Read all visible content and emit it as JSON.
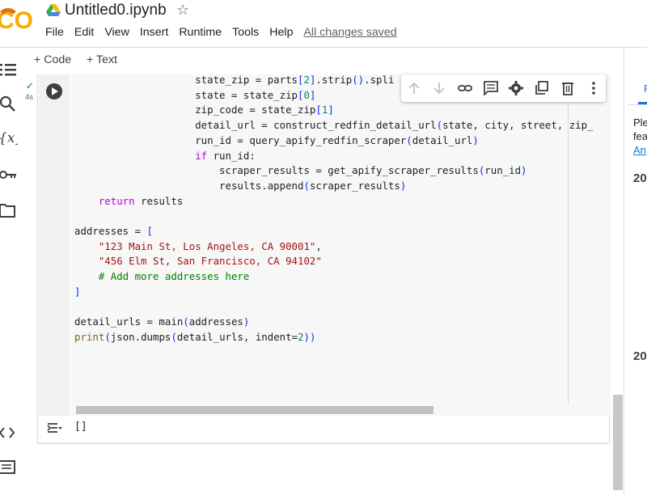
{
  "app": {
    "logo_text": "CO",
    "notebook_title": "Untitled0.ipynb",
    "menu": [
      "File",
      "Edit",
      "View",
      "Insert",
      "Runtime",
      "Tools",
      "Help"
    ],
    "save_status": "All changes saved"
  },
  "toolbar": {
    "add_code": "+ Code",
    "add_text": "+ Text"
  },
  "sidebar_icons": [
    "table-of-contents-icon",
    "search-icon",
    "variables-icon",
    "key-icon",
    "folder-icon",
    "code-snippets-icon",
    "terminal-icon"
  ],
  "cell": {
    "status": "✓",
    "exec_time": "4s",
    "code_lines": [
      "                    state_zip = parts[2].strip().spli",
      "                    state = state_zip[0]",
      "                    zip_code = state_zip[1]",
      "                    detail_url = construct_redfin_detail_url(state, city, street, zip_",
      "                    run_id = query_apify_redfin_scraper(detail_url)",
      "                    if run_id:",
      "                        scraper_results = get_apify_scraper_results(run_id)",
      "                        results.append(scraper_results)",
      "    return results",
      "",
      "addresses = [",
      "    \"123 Main St, Los Angeles, CA 90001\",",
      "    \"456 Elm St, San Francisco, CA 94102\"",
      "    # Add more addresses here",
      "]",
      "",
      "detail_urls = main(addresses)",
      "print(json.dumps(detail_urls, indent=2))"
    ],
    "output": "[]"
  },
  "cell_toolbar_icons": [
    "move-up-icon",
    "move-down-icon",
    "link-icon",
    "comment-icon",
    "settings-icon",
    "mirror-cell-icon",
    "delete-icon",
    "more-options-icon"
  ],
  "right_panel": {
    "tab_label": "F",
    "text_line1": "Ple",
    "text_line2": "fea",
    "link": "An",
    "heading1": "20",
    "heading2": "20"
  },
  "colors": {
    "accent": "#1a73e8",
    "keyword": "#af00db",
    "string": "#a31515",
    "number": "#098658",
    "comment": "#008000",
    "success": "#188038"
  }
}
